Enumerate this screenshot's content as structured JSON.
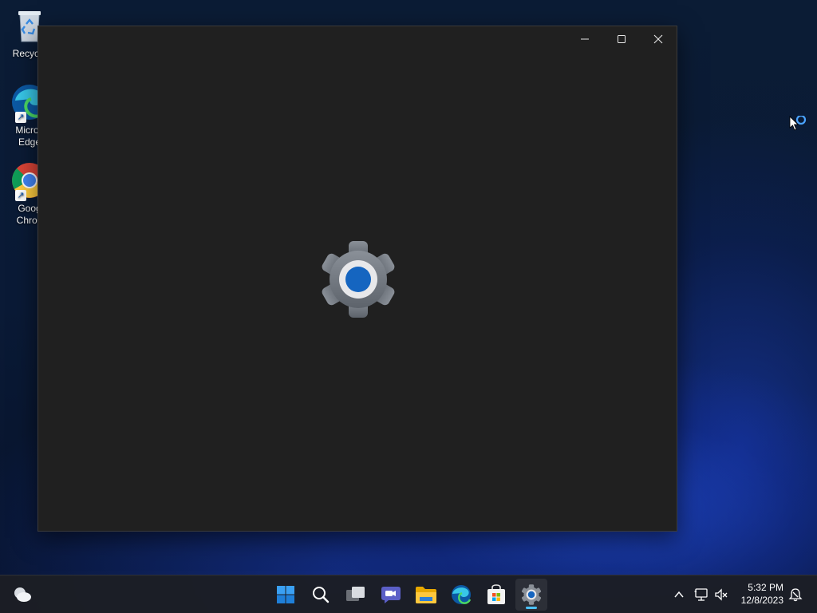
{
  "desktop": {
    "icons": [
      {
        "label": "Recycle",
        "icon": "recycle-bin-icon"
      },
      {
        "label": "Micros Edge",
        "line1": "Micros",
        "line2": "Edge",
        "icon": "edge-icon"
      },
      {
        "label": "Goog Chron",
        "line1": "Goog",
        "line2": "Chron",
        "icon": "chrome-icon"
      }
    ]
  },
  "window": {
    "caption_buttons": [
      "minimize",
      "maximize",
      "close"
    ],
    "splash_icon": "settings-gear-icon"
  },
  "taskbar": {
    "apps": [
      {
        "name": "start",
        "icon": "windows-start-icon"
      },
      {
        "name": "search",
        "icon": "search-icon"
      },
      {
        "name": "task-view",
        "icon": "task-view-icon"
      },
      {
        "name": "chat",
        "icon": "teams-chat-icon"
      },
      {
        "name": "file-explorer",
        "icon": "folder-icon"
      },
      {
        "name": "edge",
        "icon": "edge-icon"
      },
      {
        "name": "store",
        "icon": "store-icon"
      },
      {
        "name": "settings",
        "icon": "settings-gear-icon",
        "active": true
      }
    ],
    "tray": [
      "chevron-up-icon",
      "network-icon",
      "volume-muted-icon"
    ],
    "time": "5:32 PM",
    "date": "12/8/2023"
  },
  "colors": {
    "accent": "#4cc2ff",
    "window_bg": "#202020",
    "gear_center": "#1565c0"
  }
}
